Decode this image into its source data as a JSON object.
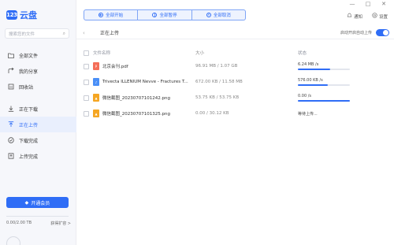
{
  "window": {
    "minimize": "—",
    "maximize": "□",
    "close": "✕"
  },
  "app": {
    "logo_badge": "123",
    "name": "云盘"
  },
  "search": {
    "placeholder": "搜索您的文件"
  },
  "sidebar": {
    "items": [
      {
        "label": "全部文件",
        "icon": "folder-icon",
        "active": false
      },
      {
        "label": "我的分享",
        "icon": "share-icon",
        "active": false
      },
      {
        "label": "回收站",
        "icon": "trash-icon",
        "active": false
      },
      {
        "label": "正在下载",
        "icon": "download-icon",
        "active": false
      },
      {
        "label": "正在上传",
        "icon": "upload-icon",
        "active": true
      },
      {
        "label": "下载完成",
        "icon": "check-circle-icon",
        "active": false
      },
      {
        "label": "上传完成",
        "icon": "upload-done-icon",
        "active": false
      }
    ],
    "vip_button": "开通会员",
    "quota": {
      "text": "0.00/2.00 TB",
      "expand": "获得扩容 >",
      "used_fraction": 0.0
    }
  },
  "toolbar": {
    "buttons": [
      {
        "label": "全部开始",
        "icon": "play-icon"
      },
      {
        "label": "全部暂停",
        "icon": "pause-icon"
      },
      {
        "label": "全部取消",
        "icon": "cancel-icon"
      }
    ]
  },
  "top_right": {
    "notify": "通知",
    "settings": "设置"
  },
  "header": {
    "title": "正在上传",
    "autostart": "启动开启自动上传",
    "autostart_on": true
  },
  "table": {
    "columns": [
      "文件名称",
      "大小",
      "状态"
    ],
    "rows": [
      {
        "name": "北京会刊.pdf",
        "type": "pdf",
        "size": "96.91 MB / 1.07 GB",
        "status": "6.24 MB /s",
        "progress": 0.62
      },
      {
        "name": "Trivecta ILLENIUM Nevve - Fractures T...",
        "type": "music",
        "size": "672.00 KB / 11.58 MB",
        "status": "576.00 KB /s",
        "progress": 0.58
      },
      {
        "name": "微信截图_20230707101242.png",
        "type": "img",
        "size": "53.75 KB / 53.75 KB",
        "status": "0.00 /s",
        "progress": 1.0
      },
      {
        "name": "微信截图_20230707101325.png",
        "type": "img",
        "size": "0.00 / 30.12 KB",
        "status": "等待上传...",
        "progress": null
      }
    ]
  },
  "colors": {
    "accent": "#2f6df6",
    "sidebar_bg": "#f6f7fb"
  }
}
